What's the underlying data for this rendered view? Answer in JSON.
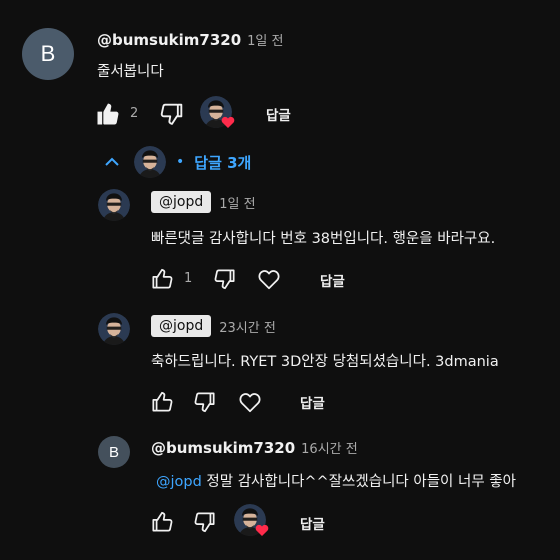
{
  "colors": {
    "background": "#0f0f0f",
    "link_blue": "#3ea6ff",
    "heart_red": "#ff2b4b",
    "chip_bg": "#e9e9e9"
  },
  "icons": [
    "thumb-up-icon",
    "thumb-down-icon",
    "heart-outline-icon",
    "creator-heart-icon",
    "chevron-up-icon"
  ],
  "main_comment": {
    "avatar_letter": "B",
    "author": "@bumsukim7320",
    "time": "1일 전",
    "text": "줄서봅니다",
    "like_count": "2",
    "reply_label": "답글"
  },
  "replies_toggle": {
    "label": "답글 3개",
    "bullet": "•"
  },
  "replies": [
    {
      "author": "@jopd",
      "time": "1일 전",
      "text": "빠른댓글 감사합니다 번호 38번입니다. 행운을 바라구요.",
      "like_count": "1",
      "reply_label": "답글"
    },
    {
      "author": "@jopd",
      "time": "23시간 전",
      "text": "축하드립니다. RYET 3D안장 당첨되셨습니다. 3dmania",
      "reply_label": "답글"
    },
    {
      "avatar_letter": "B",
      "author": "@bumsukim7320",
      "time": "16시간 전",
      "mention": "@jopd",
      "text": " 정말 감사합니다^^잘쓰겠습니다 아들이 너무 좋아",
      "reply_label": "답글"
    }
  ]
}
